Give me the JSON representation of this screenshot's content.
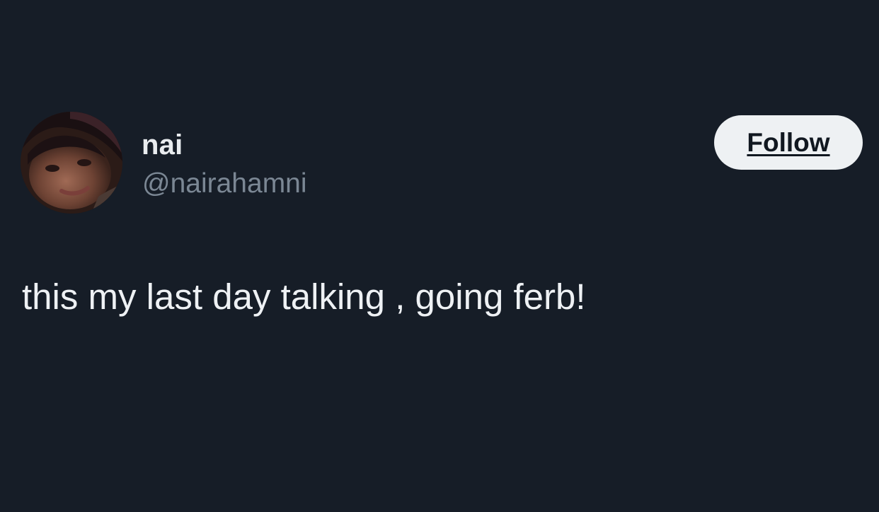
{
  "tweet": {
    "author": {
      "display_name": "nai",
      "handle": "@nairahamni",
      "avatar_icon": "profile-photo"
    },
    "follow_label": "Follow",
    "text": "this my last day talking , going ferb!"
  },
  "colors": {
    "background": "#161d27",
    "primary_text": "#eef1f4",
    "secondary_text": "#7b8794",
    "follow_button_bg": "#eef1f3",
    "follow_button_text": "#111820"
  }
}
